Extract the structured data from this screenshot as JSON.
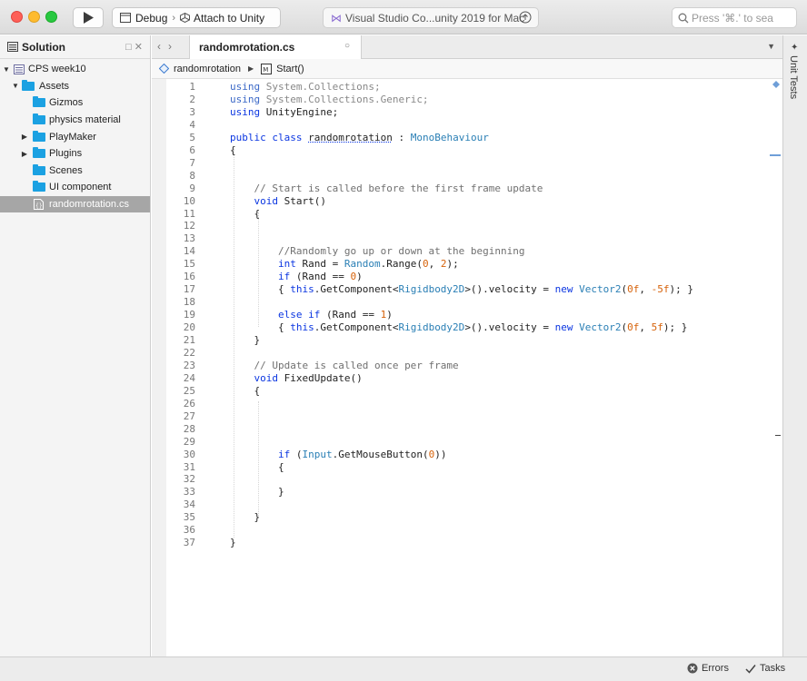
{
  "toolbar": {
    "configuration": "Debug",
    "target": "Attach to Unity",
    "status_text": "Visual Studio Co...unity 2019 for Mac",
    "search_placeholder": "Press '⌘.' to sea"
  },
  "solution_pane": {
    "title": "Solution",
    "controls": "□ ✕",
    "items": [
      {
        "label": "CPS week10",
        "arrow": "▼"
      },
      {
        "label": "Assets",
        "arrow": "▼"
      },
      {
        "label": "Gizmos",
        "arrow": ""
      },
      {
        "label": "physics material",
        "arrow": ""
      },
      {
        "label": "PlayMaker",
        "arrow": "▶"
      },
      {
        "label": "Plugins",
        "arrow": "▶"
      },
      {
        "label": "Scenes",
        "arrow": ""
      },
      {
        "label": "UI component",
        "arrow": ""
      },
      {
        "label": "randomrotation.cs",
        "arrow": ""
      }
    ]
  },
  "editor": {
    "tab_label": "randomrotation.cs",
    "tab_close": "○",
    "breadcrumb": {
      "class_name": "randomrotation",
      "method": "Start()"
    },
    "lines": [
      {
        "n": "1",
        "html": "<span class=\"using\">using</span> <span class=\"dim\">System.Collections;</span>"
      },
      {
        "n": "2",
        "html": "<span class=\"using\">using</span> <span class=\"dim\">System.Collections.Generic;</span>"
      },
      {
        "n": "3",
        "html": "<span class=\"kw\">using</span> UnityEngine;"
      },
      {
        "n": "4",
        "html": ""
      },
      {
        "n": "5",
        "html": "<span class=\"kw\">public</span> <span class=\"kw\">class</span> <span style=\"text-decoration: underline dotted #0b36e1;\">randomrotation</span> : <span class=\"ty\">MonoBehaviour</span>"
      },
      {
        "n": "6",
        "html": "{"
      },
      {
        "n": "7",
        "html": ""
      },
      {
        "n": "8",
        "html": ""
      },
      {
        "n": "9",
        "html": "    <span class=\"cm\">// Start is called before the first frame update</span>"
      },
      {
        "n": "10",
        "html": "    <span class=\"kw\">void</span> Start()"
      },
      {
        "n": "11",
        "html": "    {"
      },
      {
        "n": "12",
        "html": ""
      },
      {
        "n": "13",
        "html": ""
      },
      {
        "n": "14",
        "html": "        <span class=\"cm\">//Randomly go up or down at the beginning</span>"
      },
      {
        "n": "15",
        "html": "        <span class=\"kw\">int</span> Rand = <span class=\"ty\">Random</span>.Range(<span class=\"nm\">0</span>, <span class=\"nm\">2</span>);"
      },
      {
        "n": "16",
        "html": "        <span class=\"kw\">if</span> (Rand == <span class=\"nm\">0</span>)"
      },
      {
        "n": "17",
        "html": "        { <span class=\"kw\">this</span>.GetComponent&lt;<span class=\"ty\">Rigidbody2D</span>&gt;().velocity = <span class=\"kw\">new</span> <span class=\"ty\">Vector2</span>(<span class=\"nm\">0f</span>, <span class=\"nm\">-5f</span>); }"
      },
      {
        "n": "18",
        "html": ""
      },
      {
        "n": "19",
        "html": "        <span class=\"kw\">else</span> <span class=\"kw\">if</span> (Rand == <span class=\"nm\">1</span>)"
      },
      {
        "n": "20",
        "html": "        { <span class=\"kw\">this</span>.GetComponent&lt;<span class=\"ty\">Rigidbody2D</span>&gt;().velocity = <span class=\"kw\">new</span> <span class=\"ty\">Vector2</span>(<span class=\"nm\">0f</span>, <span class=\"nm\">5f</span>); }"
      },
      {
        "n": "21",
        "html": "    }"
      },
      {
        "n": "22",
        "html": ""
      },
      {
        "n": "23",
        "html": "    <span class=\"cm\">// Update is called once per frame</span>"
      },
      {
        "n": "24",
        "html": "    <span class=\"kw\">void</span> FixedUpdate()"
      },
      {
        "n": "25",
        "html": "    {"
      },
      {
        "n": "26",
        "html": ""
      },
      {
        "n": "27",
        "html": ""
      },
      {
        "n": "28",
        "html": ""
      },
      {
        "n": "29",
        "html": ""
      },
      {
        "n": "30",
        "html": "        <span class=\"kw\">if</span> (<span class=\"ty\">Input</span>.GetMouseButton(<span class=\"nm\">0</span>))"
      },
      {
        "n": "31",
        "html": "        {"
      },
      {
        "n": "32",
        "html": ""
      },
      {
        "n": "33",
        "html": "        }"
      },
      {
        "n": "34",
        "html": ""
      },
      {
        "n": "35",
        "html": "    }"
      },
      {
        "n": "36",
        "html": ""
      },
      {
        "n": "37",
        "html": "}"
      }
    ]
  },
  "right_panel": {
    "label": "Unit Tests"
  },
  "statusbar": {
    "errors": "Errors",
    "tasks": "Tasks"
  }
}
